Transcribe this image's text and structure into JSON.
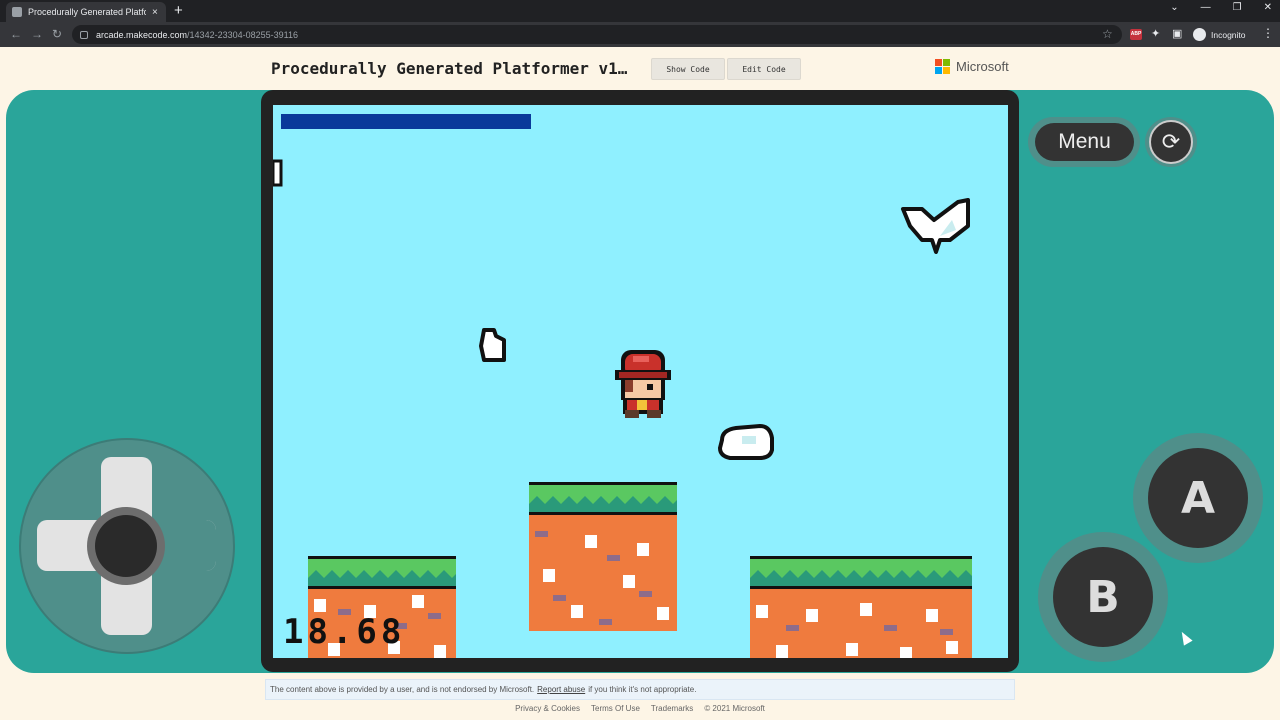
{
  "browser": {
    "tab_title": "Procedurally Generated Platform",
    "tab_close": "×",
    "new_tab": "+",
    "url_host": "arcade.makecode.com",
    "url_path": "/14342-23304-08255-39116",
    "incognito_label": "Incognito",
    "abp_label": "ABP",
    "win_minimize": "—",
    "win_restore": "❐",
    "win_close": "✕"
  },
  "header": {
    "title": "Procedurally Generated Platformer v1…",
    "show_code": "Show Code",
    "edit_code": "Edit Code",
    "brand": "Microsoft"
  },
  "simulator": {
    "menu_label": "Menu",
    "refresh_icon": "⟳",
    "a_label": "A",
    "b_label": "B"
  },
  "game": {
    "score": "18.68",
    "health_fraction": 0.34
  },
  "notice": {
    "prefix": "The content above is provided by a user, and is not endorsed by Microsoft.",
    "link": "Report abuse",
    "suffix": "if you think it's not appropriate."
  },
  "footer": {
    "privacy": "Privacy & Cookies",
    "terms": "Terms Of Use",
    "trademarks": "Trademarks",
    "copyright": "© 2021 Microsoft"
  },
  "colors": {
    "simulator_bg": "#2aa59a",
    "sky": "#8ff0ff",
    "health": "#0a3a9a",
    "grass": "#5ac861",
    "dirt": "#ef7b3e"
  }
}
